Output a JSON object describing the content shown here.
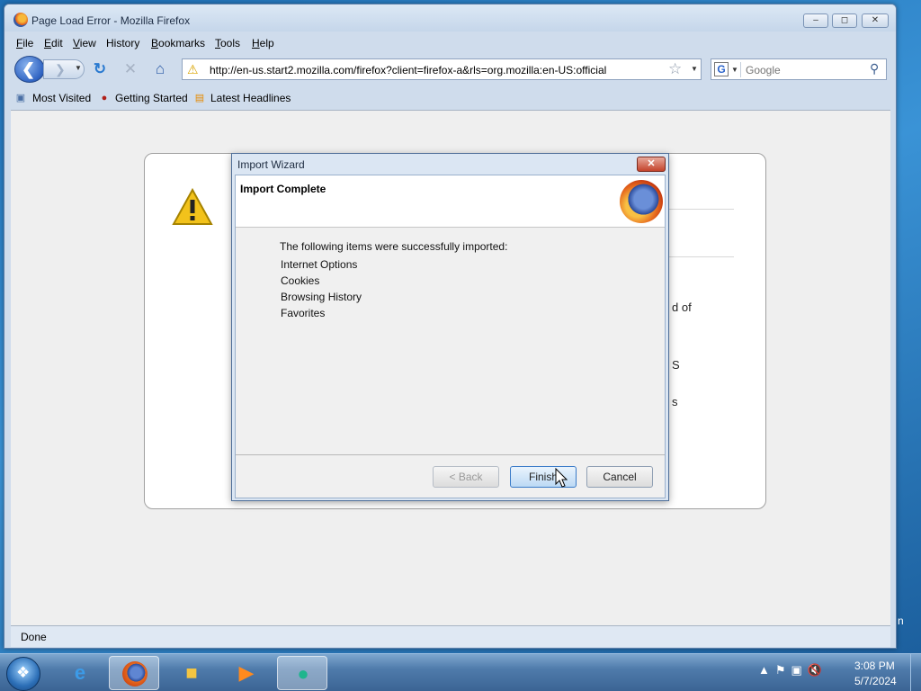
{
  "window": {
    "title": "Page Load Error - Mozilla Firefox",
    "controls": [
      "minimize",
      "maximize",
      "close"
    ]
  },
  "menu": {
    "items": [
      {
        "label": "File",
        "mnemonic": "F",
        "rest": "ile"
      },
      {
        "label": "Edit",
        "mnemonic": "E",
        "rest": "dit"
      },
      {
        "label": "View",
        "mnemonic": "V",
        "rest": "iew"
      },
      {
        "label": "History",
        "mnemonic": "",
        "rest": "History"
      },
      {
        "label": "Bookmarks",
        "mnemonic": "B",
        "rest": "ookmarks"
      },
      {
        "label": "Tools",
        "mnemonic": "T",
        "rest": "ools"
      },
      {
        "label": "Help",
        "mnemonic": "H",
        "rest": "elp"
      }
    ]
  },
  "navigation": {
    "url": "http://en-us.start2.mozilla.com/firefox?client=firefox-a&rls=org.mozilla:en-US:official",
    "search_engine_icon": "G",
    "search_placeholder": "Google"
  },
  "bookmarks": {
    "items": [
      "Most Visited",
      "Getting Started",
      "Latest Headlines"
    ]
  },
  "error_page": {
    "fragments": [
      "d of",
      "S",
      "s"
    ]
  },
  "status": {
    "text": "Done"
  },
  "dialog": {
    "title": "Import Wizard",
    "heading": "Import Complete",
    "intro": "The following items were successfully imported:",
    "items": [
      "Internet Options",
      "Cookies",
      "Browsing History",
      "Favorites"
    ],
    "buttons": {
      "back": "< Back",
      "finish": "Finish",
      "cancel": "Cancel"
    }
  },
  "taskbar": {
    "right_edge_fragment": "n",
    "time": "3:08 PM",
    "date": "5/7/2024"
  },
  "colors": {
    "dialog_frame": "#dbe6f3",
    "close_red": "#c4432b",
    "desktop_blue": "#3a93d6"
  }
}
